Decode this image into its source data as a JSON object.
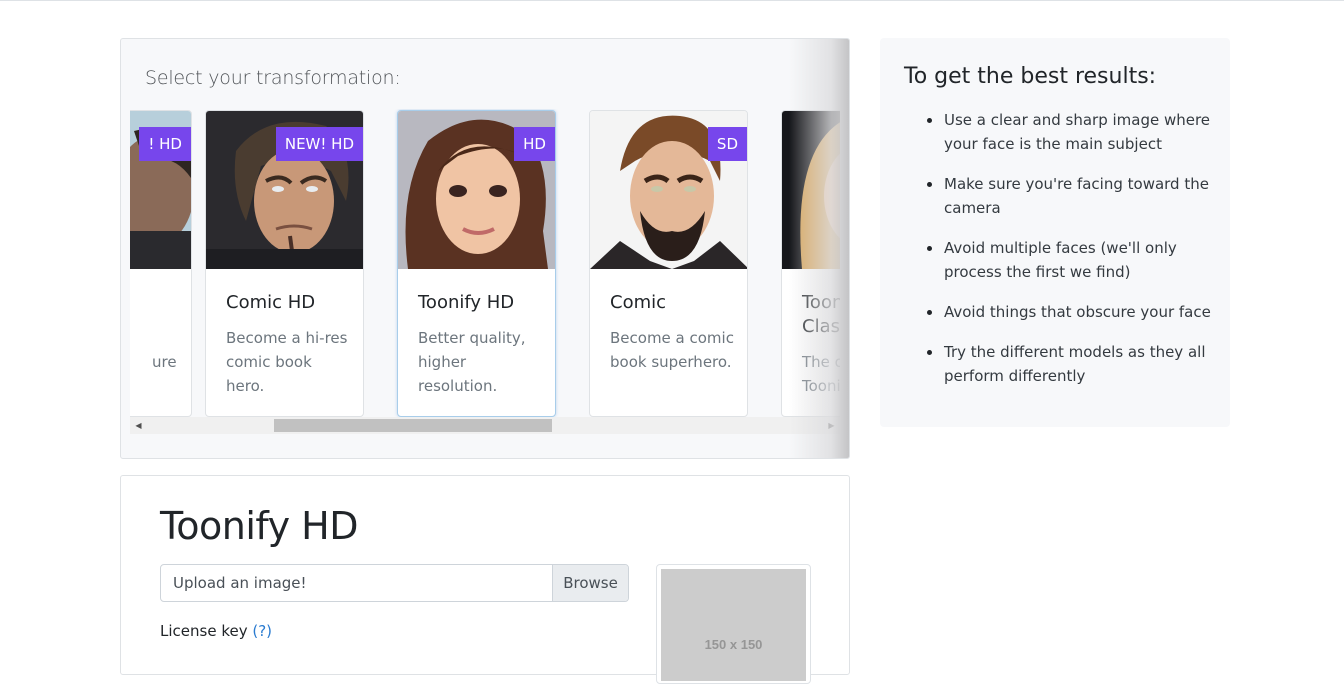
{
  "selector": {
    "title": "Select your transformation:",
    "cards": [
      {
        "title": "",
        "description": "ure",
        "badge": "! HD",
        "selected": false,
        "portrait": "man-suit-lightbg"
      },
      {
        "title": "Comic HD",
        "description": "Become a hi-res comic book hero.",
        "badge": "NEW! HD",
        "selected": false,
        "portrait": "man-long-hair-dark"
      },
      {
        "title": "Toonify HD",
        "description": "Better quality, higher resolution.",
        "badge": "HD",
        "selected": true,
        "portrait": "woman-brown-hair"
      },
      {
        "title": "Comic",
        "description": "Become a comic book superhero.",
        "badge": "SD",
        "selected": false,
        "portrait": "man-beard-suit"
      },
      {
        "title": "Toonify Classic",
        "description": "The original Toonify",
        "badge": "",
        "selected": false,
        "portrait": "woman-blonde"
      }
    ]
  },
  "tips": {
    "title": "To get the best results:",
    "items": [
      "Use a clear and sharp image where your face is the main subject",
      "Make sure you're facing toward the camera",
      "Avoid multiple faces (we'll only process the first we find)",
      "Avoid things that obscure your face",
      "Try the different models as they all perform differently"
    ]
  },
  "upload": {
    "heading": "Toonify HD",
    "file_placeholder": "Upload an image!",
    "browse_label": "Browse",
    "license_label": "License key",
    "license_help": "(?)",
    "preview_placeholder": "150 x 150"
  },
  "colors": {
    "badge": "#7746ec",
    "link": "#2a7bd0",
    "panel_bg": "#f7f8fa"
  }
}
